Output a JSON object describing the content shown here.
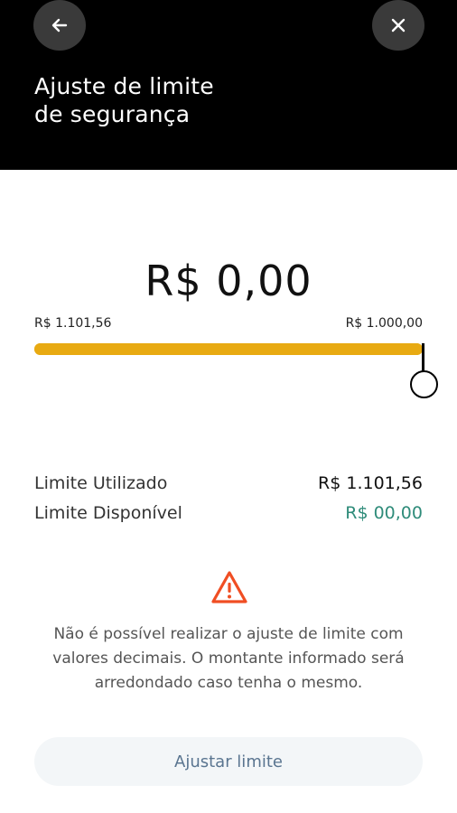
{
  "header": {
    "title_line1": "Ajuste de limite",
    "title_line2": "de segurança",
    "back_icon": "arrow-left-icon",
    "close_icon": "close-icon"
  },
  "amount": "R$ 0,00",
  "slider": {
    "min_label": "R$ 1.101,56",
    "max_label": "R$ 1.000,00",
    "value_fraction": 1.0,
    "accent_color": "#e8aa12"
  },
  "limits": {
    "used_label": "Limite Utilizado",
    "used_value": "R$ 1.101,56",
    "available_label": "Limite Disponível",
    "available_value": "R$ 00,00",
    "available_color": "#2f8c7a"
  },
  "warning": {
    "icon": "warning-icon",
    "icon_color": "#f04e23",
    "line1": "Não é possível realizar o ajuste de limite com",
    "line2": "valores decimais. O montante informado será",
    "line3": "arredondado caso tenha o mesmo."
  },
  "action": {
    "label": "Ajustar limite"
  }
}
